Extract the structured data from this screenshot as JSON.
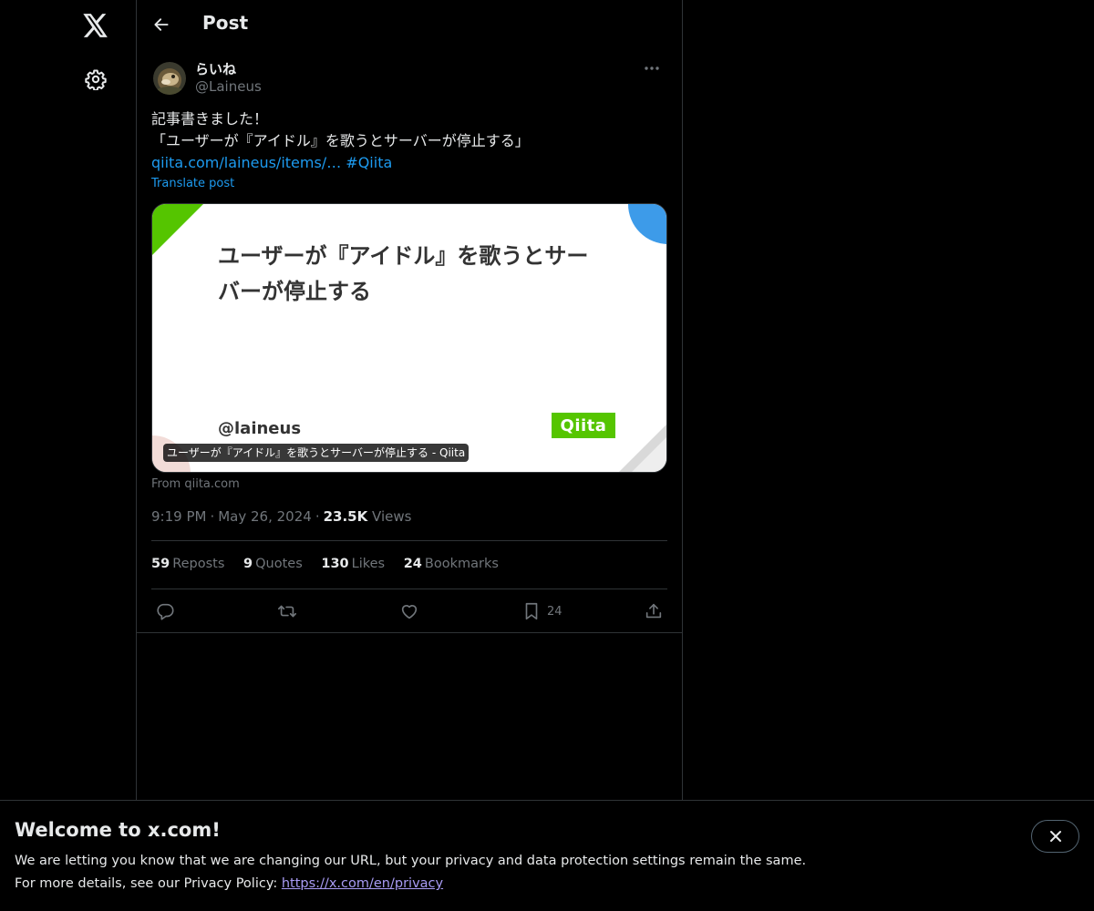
{
  "header": {
    "title": "Post"
  },
  "author": {
    "display_name": "らいね",
    "handle": "@Laineus"
  },
  "post": {
    "line1": "記事書きました！",
    "line2": "「ユーザーが『アイドル』を歌うとサーバーが停止する」",
    "link_text": "qiita.com/laineus/items/…",
    "hashtag": "#Qiita",
    "translate_label": "Translate post"
  },
  "card": {
    "title_line1": "ユーザーが『アイドル』を歌うとサー",
    "title_line2": "バーが停止する",
    "handle": "@laineus",
    "logo_text": "Qiita",
    "caption": "ユーザーが『アイドル』を歌うとサーバーが停止する - Qiita",
    "from": "From qiita.com"
  },
  "meta": {
    "time": "9:19 PM",
    "date": "May 26, 2024",
    "views_count": "23.5K",
    "views_label": "Views"
  },
  "stats": [
    {
      "num": "59",
      "label": "Reposts"
    },
    {
      "num": "9",
      "label": "Quotes"
    },
    {
      "num": "130",
      "label": "Likes"
    },
    {
      "num": "24",
      "label": "Bookmarks"
    }
  ],
  "actions": {
    "bookmark_count": "24"
  },
  "banner": {
    "title": "Welcome to x.com!",
    "line1": "We are letting you know that we are changing our URL, but your privacy and data protection settings remain the same.",
    "line2_prefix": "For more details, see our Privacy Policy: ",
    "link": "https://x.com/en/privacy"
  },
  "colors": {
    "background": "#000000",
    "accent": "#1d9bf0",
    "muted": "#71767b",
    "text": "#e7e9ea",
    "qiita_green": "#55c500"
  },
  "icons": [
    "x-logo-icon",
    "gear-icon",
    "back-arrow-icon",
    "more-icon",
    "reply-icon",
    "repost-icon",
    "like-icon",
    "bookmark-icon",
    "share-icon",
    "close-icon"
  ]
}
